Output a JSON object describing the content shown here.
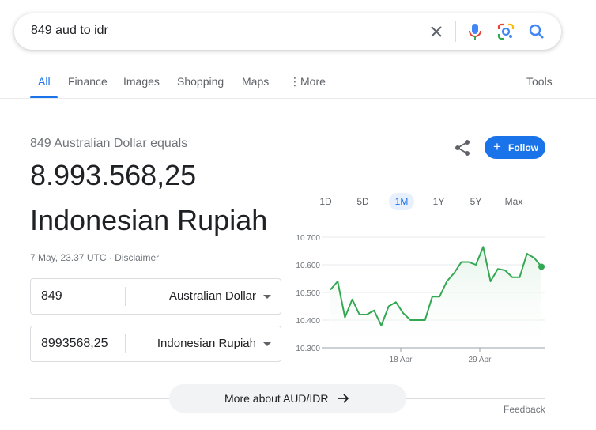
{
  "search": {
    "query": "849 aud to idr"
  },
  "tabs": [
    {
      "label": "All",
      "active": true
    },
    {
      "label": "Finance"
    },
    {
      "label": "Images"
    },
    {
      "label": "Shopping"
    },
    {
      "label": "Maps"
    },
    {
      "label": "More"
    }
  ],
  "tools_label": "Tools",
  "result": {
    "equals_text": "849 Australian Dollar equals",
    "amount": "8.993.568,25",
    "currency_name": "Indonesian Rupiah",
    "timestamp": "7 May, 23.37 UTC · ",
    "disclaimer": "Disclaimer"
  },
  "converter": {
    "from": {
      "value": "849",
      "currency": "Australian Dollar"
    },
    "to": {
      "value": "8993568,25",
      "currency": "Indonesian Rupiah"
    }
  },
  "follow_label": "Follow",
  "ranges": [
    "1D",
    "5D",
    "1M",
    "1Y",
    "5Y",
    "Max"
  ],
  "active_range": "1M",
  "chart_data": {
    "type": "area",
    "y_ticks": [
      "10.700",
      "10.600",
      "10.500",
      "10.400",
      "10.300"
    ],
    "ylim": [
      10.3,
      10.7
    ],
    "x_ticks": [
      "18 Apr",
      "29 Apr"
    ],
    "values": [
      10.51,
      10.54,
      10.41,
      10.475,
      10.42,
      10.42,
      10.435,
      10.38,
      10.45,
      10.465,
      10.425,
      10.4,
      10.4,
      10.4,
      10.485,
      10.485,
      10.54,
      10.57,
      10.61,
      10.61,
      10.6,
      10.665,
      10.54,
      10.585,
      10.58,
      10.555,
      10.555,
      10.64,
      10.625,
      10.593
    ],
    "line_color": "#34a853",
    "fill_color": "#e6f4ea"
  },
  "more_button_label": "More about AUD/IDR",
  "feedback_label": "Feedback"
}
